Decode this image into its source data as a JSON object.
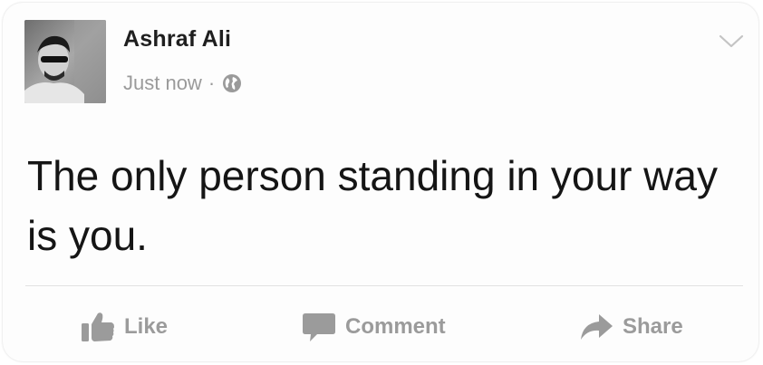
{
  "post": {
    "author_name": "Ashraf Ali",
    "timestamp": "Just now",
    "separator": "·",
    "privacy_icon": "globe-icon",
    "text": "The only person standing in your way is you.",
    "menu_icon": "chevron-down-icon"
  },
  "actions": {
    "like": {
      "label": "Like",
      "icon": "thumbs-up-icon"
    },
    "comment": {
      "label": "Comment",
      "icon": "speech-bubble-icon"
    },
    "share": {
      "label": "Share",
      "icon": "share-arrow-icon"
    }
  },
  "colors": {
    "name": "#1f1f1f",
    "meta": "#9a9a9a",
    "body_text": "#151515",
    "action": "#9b9b9b",
    "divider": "#e2e2e2"
  }
}
